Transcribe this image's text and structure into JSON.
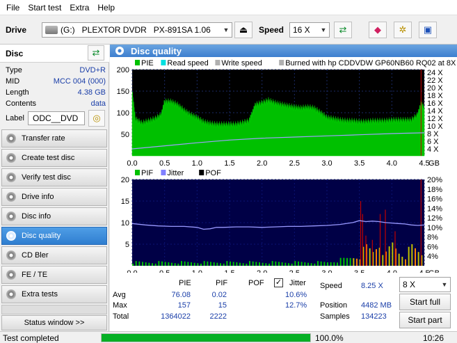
{
  "menu": [
    "File",
    "Start test",
    "Extra",
    "Help"
  ],
  "drive": {
    "label": "Drive",
    "device": "(G:)   PLEXTOR DVDR   PX-891SA 1.06",
    "speed_label": "Speed",
    "speed_value": "16 X"
  },
  "disc": {
    "header": "Disc",
    "rows": [
      {
        "k": "Type",
        "v": "DVD+R"
      },
      {
        "k": "MID",
        "v": "MCC 004 (000)"
      },
      {
        "k": "Length",
        "v": "4.38 GB"
      },
      {
        "k": "Contents",
        "v": "data"
      }
    ],
    "label_key": "Label",
    "label_value": "ODC__DVD"
  },
  "nav": [
    "Transfer rate",
    "Create test disc",
    "Verify test disc",
    "Drive info",
    "Disc info",
    "Disc quality",
    "CD Bler",
    "FE / TE",
    "Extra tests"
  ],
  "nav_active": "Disc quality",
  "status_window": "Status window >>",
  "panel_title": "Disc quality",
  "chart_data": [
    {
      "type": "area",
      "legend": [
        "PIE",
        "Read speed",
        "Write speed",
        "Burned with hp CDDVDW GP60NB60 RQ02 at 8X"
      ],
      "legend_colors": [
        "#00c000",
        "#00e0e0",
        "#b0b0b0",
        "#b0b0b0"
      ],
      "xlim": [
        0,
        4.5
      ],
      "x_ticks": [
        "0.0",
        "0.5",
        "1.0",
        "1.5",
        "2.0",
        "2.5",
        "3.0",
        "3.5",
        "4.0",
        "4.5"
      ],
      "x_unit": "GB",
      "ylim": [
        0,
        200
      ],
      "y_ticks": [
        "50",
        "100",
        "150",
        "200"
      ],
      "y2_ticks": [
        "4 X",
        "6 X",
        "8 X",
        "10 X",
        "12 X",
        "14 X",
        "16 X",
        "18 X",
        "20 X",
        "22 X",
        "24 X"
      ],
      "series": [
        {
          "name": "PIE",
          "x": [
            0.0,
            0.05,
            0.15,
            0.25,
            0.35,
            0.45,
            0.5,
            0.6,
            0.7,
            0.8,
            0.9,
            1.0,
            1.1,
            1.2,
            1.3,
            1.4,
            1.5,
            1.6,
            1.7,
            1.8,
            1.85,
            1.9,
            2.0,
            2.1,
            2.2,
            2.3,
            2.4,
            2.5,
            2.6,
            2.7,
            2.8,
            2.9,
            3.0,
            3.1,
            3.2,
            3.3,
            3.4,
            3.5,
            3.6,
            3.7,
            3.8,
            3.9,
            4.0,
            4.1,
            4.2,
            4.3,
            4.4,
            4.45,
            4.5
          ],
          "y": [
            150,
            85,
            75,
            80,
            85,
            95,
            125,
            125,
            118,
            105,
            95,
            88,
            78,
            74,
            72,
            72,
            72,
            72,
            76,
            80,
            98,
            118,
            122,
            128,
            122,
            118,
            115,
            112,
            110,
            112,
            110,
            100,
            88,
            85,
            82,
            80,
            80,
            78,
            78,
            80,
            80,
            80,
            82,
            82,
            82,
            82,
            95,
            120,
            110
          ]
        },
        {
          "name": "Read speed",
          "x": [
            0.0,
            0.5,
            1.0,
            1.5,
            2.0,
            2.5,
            3.0,
            3.5,
            4.0,
            4.2,
            4.5
          ],
          "y": [
            4.0,
            4.8,
            5.6,
            6.3,
            6.8,
            7.1,
            7.4,
            7.7,
            8.0,
            8.1,
            8.2
          ]
        }
      ]
    },
    {
      "type": "area",
      "legend": [
        "PIF",
        "Jitter",
        "POF"
      ],
      "legend_colors": [
        "#00c000",
        "#8080ff",
        "#000000"
      ],
      "xlim": [
        0,
        4.5
      ],
      "x_ticks": [
        "0.0",
        "0.5",
        "1.0",
        "1.5",
        "2.0",
        "2.5",
        "3.0",
        "3.5",
        "4.0",
        "4.5"
      ],
      "x_unit": "GB",
      "ylim": [
        0,
        20
      ],
      "y_ticks": [
        "5",
        "10",
        "15",
        "20"
      ],
      "y2_ticks": [
        "4%",
        "6%",
        "8%",
        "10%",
        "12%",
        "14%",
        "16%",
        "18%",
        "20%"
      ],
      "series": [
        {
          "name": "Jitter",
          "x": [
            0.0,
            0.2,
            0.4,
            0.6,
            0.8,
            1.0,
            1.1,
            1.2,
            1.3,
            1.4,
            1.6,
            1.8,
            2.0,
            2.2,
            2.4,
            2.6,
            2.8,
            3.0,
            3.2,
            3.4,
            3.5,
            3.6,
            3.7,
            3.8,
            3.9,
            4.0,
            4.1,
            4.2,
            4.3,
            4.4,
            4.5
          ],
          "y": [
            10.8,
            10.5,
            10.3,
            10.2,
            10.2,
            10.0,
            9.6,
            9.7,
            10.0,
            10.0,
            10.1,
            10.1,
            10.0,
            10.1,
            10.2,
            10.2,
            10.3,
            10.4,
            10.6,
            11.0,
            11.4,
            11.2,
            11.3,
            11.2,
            11.0,
            10.9,
            10.8,
            10.7,
            10.5,
            10.4,
            10.5
          ]
        },
        {
          "name": "PIF",
          "x": [
            0.0,
            0.3,
            0.6,
            0.9,
            1.2,
            1.5,
            1.8,
            2.1,
            2.4,
            2.7,
            3.0,
            3.3,
            3.5,
            3.6,
            3.7,
            3.8,
            3.9,
            4.0,
            4.1,
            4.2,
            4.3,
            4.4,
            4.5
          ],
          "y": [
            1,
            1,
            1,
            1,
            1,
            1,
            1,
            1,
            1,
            1,
            1,
            2,
            3,
            5,
            4,
            7,
            3,
            6,
            4,
            3,
            5,
            4,
            3
          ]
        }
      ]
    }
  ],
  "stats": {
    "col_headers": [
      "PIE",
      "PIF",
      "POF"
    ],
    "jitter_label": "Jitter",
    "jitter_checked": true,
    "rows": [
      {
        "label": "Avg",
        "pie": "76.08",
        "pif": "0.02",
        "pof": "",
        "jitter": "10.6%"
      },
      {
        "label": "Max",
        "pie": "157",
        "pif": "15",
        "pof": "",
        "jitter": "12.7%"
      },
      {
        "label": "Total",
        "pie": "1364022",
        "pif": "2222",
        "pof": "",
        "jitter": ""
      }
    ],
    "speed_label": "Speed",
    "speed_value": "8.25 X",
    "position_label": "Position",
    "position_value": "4482 MB",
    "samples_label": "Samples",
    "samples_value": "134223",
    "speed_select": "8 X",
    "start_full": "Start full",
    "start_part": "Start part"
  },
  "status": {
    "text": "Test completed",
    "progress": 1.0,
    "percent": "100.0%",
    "time": "10:26"
  }
}
